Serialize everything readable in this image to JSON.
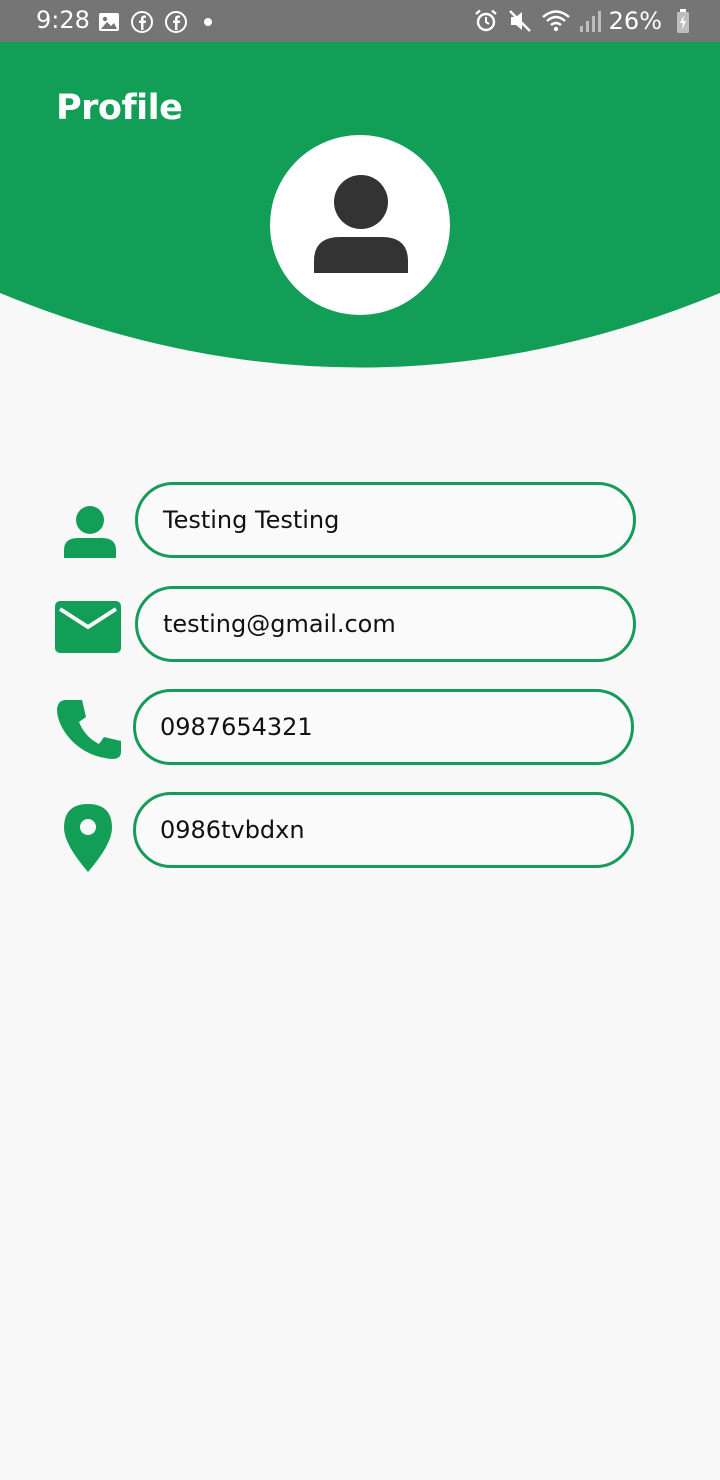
{
  "status_bar": {
    "time": "9:28",
    "battery_percent": "26%",
    "left_icons": [
      "gallery-icon",
      "facebook-icon",
      "facebook-icon",
      "dot-icon"
    ],
    "right_icons": [
      "alarm-icon",
      "mute-icon",
      "wifi-icon",
      "signal-icon",
      "battery-icon"
    ]
  },
  "header": {
    "title": "Profile",
    "color": "#129e57"
  },
  "avatar": {
    "icon": "person-icon"
  },
  "fields": {
    "name": {
      "icon": "person-icon",
      "value": "Testing Testing"
    },
    "email": {
      "icon": "mail-icon",
      "value": "testing@gmail.com"
    },
    "phone": {
      "icon": "phone-icon",
      "value": "0987654321"
    },
    "address": {
      "icon": "location-pin-icon",
      "value": "0986tvbdxn"
    }
  },
  "colors": {
    "accent": "#129e57",
    "border": "#179b5b",
    "avatar_icon": "#333333",
    "background": "#f8f8f8"
  }
}
